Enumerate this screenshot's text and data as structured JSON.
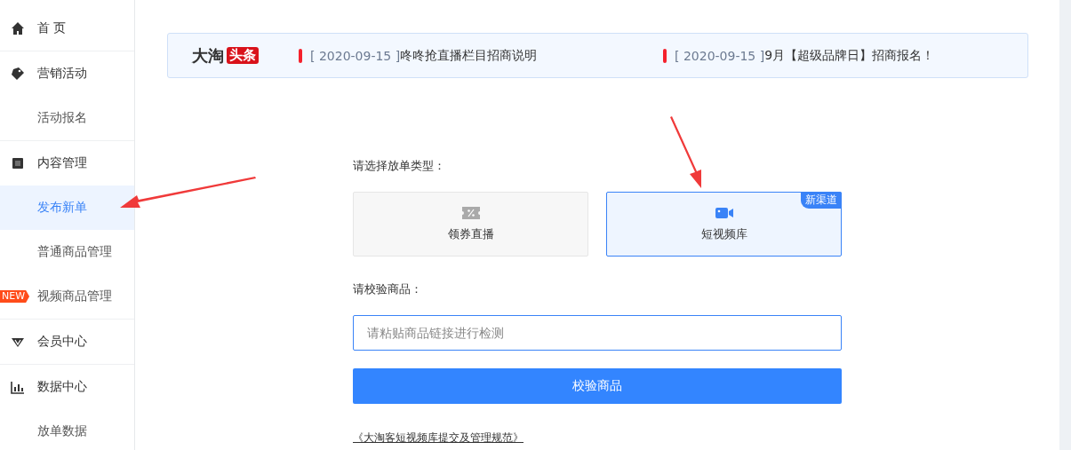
{
  "sidebar": {
    "groups": [
      {
        "label": "首 页"
      },
      {
        "label": "营销活动",
        "children": [
          {
            "label": "活动报名",
            "selected": false
          }
        ]
      },
      {
        "label": "内容管理",
        "children": [
          {
            "label": "发布新单",
            "selected": true
          },
          {
            "label": "普通商品管理",
            "selected": false
          },
          {
            "label": "视频商品管理",
            "selected": false,
            "badge": "NEW"
          }
        ]
      },
      {
        "label": "会员中心"
      },
      {
        "label": "数据中心",
        "children": [
          {
            "label": "放单数据",
            "selected": false
          }
        ]
      }
    ]
  },
  "headline": {
    "brand": "大淘",
    "brand_tag": "头条",
    "items": [
      {
        "date": "[ 2020-09-15 ]",
        "title": "咚咚抢直播栏目招商说明"
      },
      {
        "date": "[ 2020-09-15 ]",
        "title": "9月【超级品牌日】招商报名！"
      }
    ]
  },
  "order_type": {
    "label": "请选择放单类型：",
    "options": [
      {
        "label": "领券直播",
        "selected": false
      },
      {
        "label": "短视频库",
        "selected": true,
        "badge": "新渠道"
      }
    ]
  },
  "verify": {
    "label": "请校验商品：",
    "placeholder": "请粘贴商品链接进行检测",
    "button": "校验商品",
    "link": "《大淘客短视频库提交及管理规范》"
  }
}
